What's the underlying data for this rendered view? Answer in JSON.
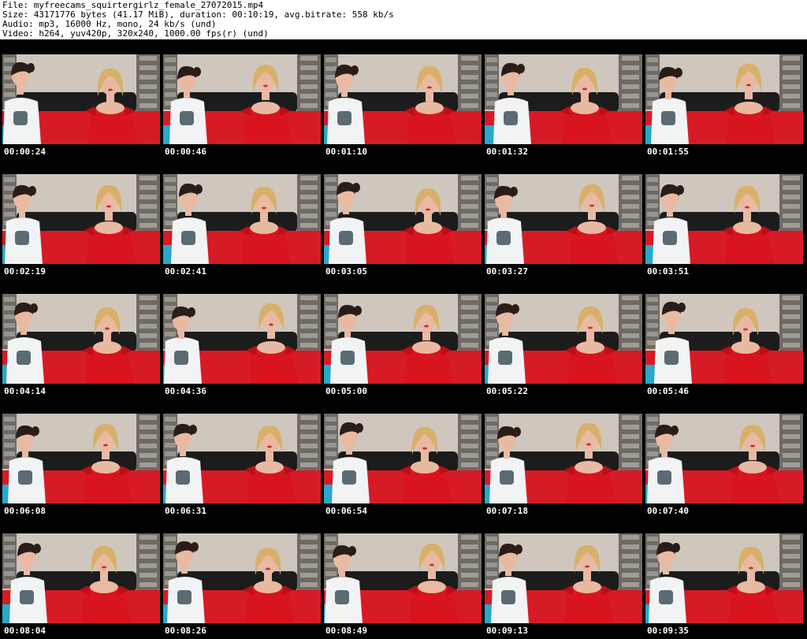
{
  "header": {
    "file_line": "File: myfreecams_squirtergirlz_female_27072015.mp4",
    "size_line": "Size: 43171776 bytes (41.17 MiB), duration: 00:10:19, avg.bitrate: 558 kb/s",
    "audio_line": "Audio: mp3, 16000 Hz, mono, 24 kb/s (und)",
    "video_line": "Video: h264, yuv420p, 320x240, 1000.00 fps(r) (und)"
  },
  "frames": [
    "00:00:24",
    "00:00:46",
    "00:01:10",
    "00:01:32",
    "00:01:55",
    "00:02:19",
    "00:02:41",
    "00:03:05",
    "00:03:27",
    "00:03:51",
    "00:04:14",
    "00:04:36",
    "00:05:00",
    "00:05:22",
    "00:05:46",
    "00:06:08",
    "00:06:31",
    "00:06:54",
    "00:07:18",
    "00:07:40",
    "00:08:04",
    "00:08:26",
    "00:08:49",
    "00:09:13",
    "00:09:35"
  ],
  "colors": {
    "background": "#000000",
    "header_bg": "#ffffff",
    "header_text": "#000000",
    "stamp_text": "#ffffff",
    "wall": "#cfc7bd",
    "brick": "#6e6a66",
    "bed_red": "#d61b27",
    "dress_red": "#d8141e",
    "shirt_white": "#f1f3f4",
    "skin": "#e9b9a2",
    "hair_dark": "#2a1d19",
    "hair_blonde": "#d9b06a",
    "headboard": "#1c1c1c",
    "pillow_blue": "#2aa7c9"
  }
}
